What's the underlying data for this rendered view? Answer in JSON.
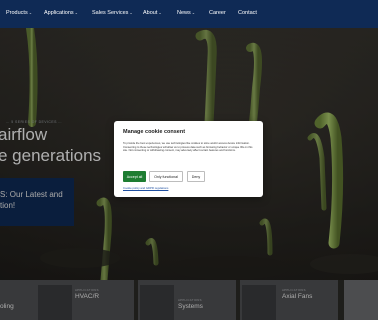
{
  "nav": {
    "items": [
      {
        "label": "Products",
        "has_dropdown": true
      },
      {
        "label": "Applications",
        "has_dropdown": true
      },
      {
        "label": "Sales Services",
        "has_dropdown": true
      },
      {
        "label": "About",
        "has_dropdown": true
      },
      {
        "label": "News",
        "has_dropdown": true
      },
      {
        "label": "Career",
        "has_dropdown": false
      },
      {
        "label": "Contact",
        "has_dropdown": false
      }
    ],
    "dropdown_icon": "chevron-down-icon",
    "bg_color": "#0f2a55"
  },
  "hero": {
    "kicker": "… 5 SERIES OF DEVICES …",
    "title_line1": "airflow",
    "title_line2": "e generations",
    "box_line1": "S: Our Latest and",
    "box_line2": "tion!",
    "box_color": "#0f2a55"
  },
  "cards": [
    {
      "kicker": "",
      "title": "oling"
    },
    {
      "kicker": "APPLICATIONS",
      "title": "HVAC/R"
    },
    {
      "kicker": "APPLICATIONS",
      "title": "Systems"
    },
    {
      "kicker": "APPLICATIONS",
      "title": "Axial Fans"
    }
  ],
  "cookie_modal": {
    "title": "Manage cookie consent",
    "body": "To provide the best experiences, we use technologies like cookies to store and/or access device information. Consenting to these technologies will allow us to process data such as browsing behavior or unique IDs on this site. Not consenting or withdrawing consent, may adversely affect certain features and functions.",
    "buttons": {
      "accept": "Accept all",
      "functional": "Only functional",
      "deny": "Deny"
    },
    "link": "Cookie policy and GDPR regulations",
    "accept_color": "#1e7d32",
    "link_color": "#1f4fa0"
  }
}
